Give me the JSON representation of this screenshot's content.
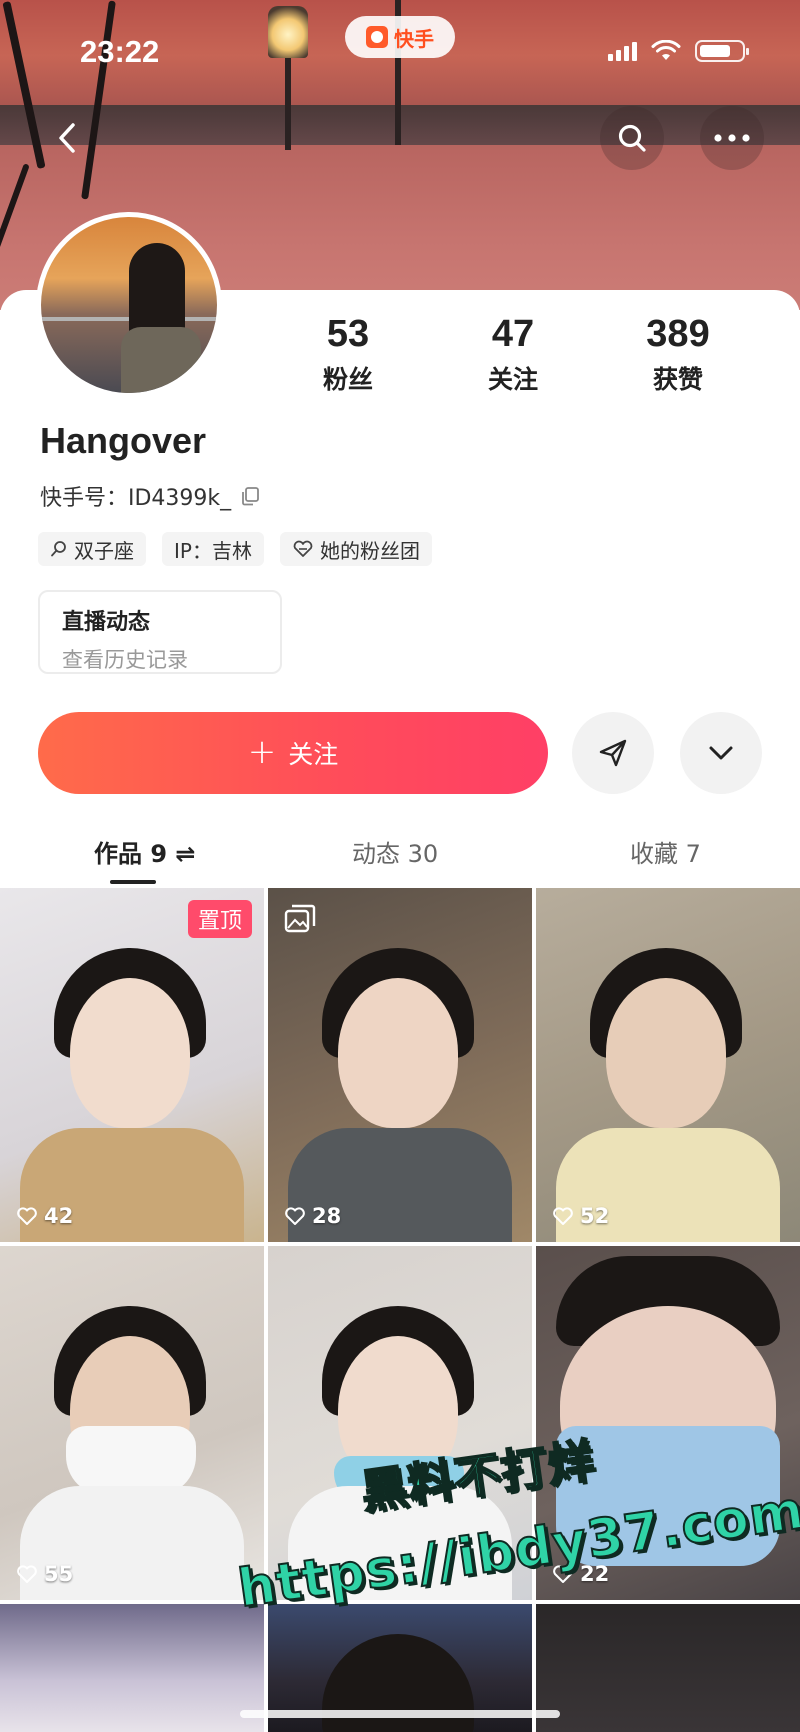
{
  "status_bar": {
    "time": "23:22",
    "app_pill": "快手",
    "icons": [
      "cellular-signal-icon",
      "wifi-icon",
      "battery-icon"
    ]
  },
  "nav": {
    "back_icon": "chevron-left-icon",
    "search_icon": "search-icon",
    "more_icon": "more-dots-icon"
  },
  "profile": {
    "stats": [
      {
        "value": "53",
        "label": "粉丝"
      },
      {
        "value": "47",
        "label": "关注"
      },
      {
        "value": "389",
        "label": "获赞"
      }
    ],
    "username": "Hangover",
    "uid_label": "快手号：ID4399k_",
    "tags": [
      {
        "icon": "search-icon",
        "text": "双子座"
      },
      {
        "icon": "",
        "text": "IP：吉林"
      },
      {
        "icon": "heart-badge-icon",
        "text": "她的粉丝团"
      }
    ],
    "live_box": {
      "title": "直播动态",
      "subtitle": "查看历史记录"
    }
  },
  "actions": {
    "follow_label": "关注",
    "follow_icon": "+",
    "share_icon": "send-icon",
    "dropdown_icon": "chevron-down-icon"
  },
  "tabs": [
    {
      "label": "作品 9 ⇌",
      "active": true
    },
    {
      "label": "动态 30",
      "active": false
    },
    {
      "label": "收藏 7",
      "active": false
    }
  ],
  "grid": [
    {
      "likes": "42",
      "badge": "置顶"
    },
    {
      "likes": "28",
      "badge": ""
    },
    {
      "likes": "52",
      "badge": ""
    },
    {
      "likes": "55",
      "badge": ""
    },
    {
      "likes": "",
      "badge": ""
    },
    {
      "likes": "22",
      "badge": ""
    }
  ],
  "watermark": {
    "line1": "黑料不打烊",
    "line2": "https://ibdy37.com"
  },
  "colors": {
    "accent": "#ff4c5a",
    "pin_badge": "#ff4b6b",
    "kuaishou": "#ff5a2a"
  }
}
